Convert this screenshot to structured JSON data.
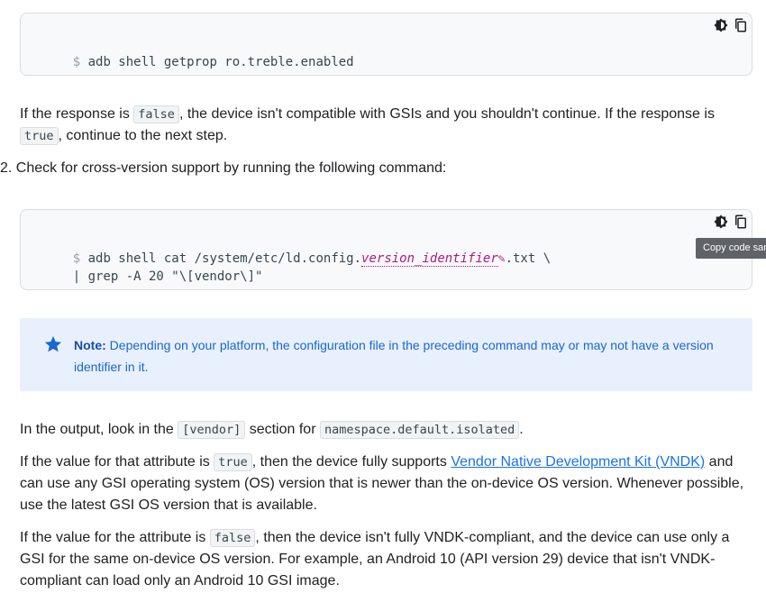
{
  "code_block_1": {
    "prompt": "$",
    "command": "adb shell getprop ro.treble.enabled"
  },
  "para_1": {
    "text_a": "If the response is ",
    "code_a": "false",
    "text_b": ", the device isn't compatible with GSIs and you shouldn't continue. If the response is",
    "code_b": "true",
    "text_c": ", continue to the next step."
  },
  "step_2": {
    "number": "2.",
    "text": "Check for cross-version support by running the following command:"
  },
  "code_block_2": {
    "prompt": "$",
    "line1_a": "adb shell cat /system/etc/ld.config.",
    "line1_var": "version_identifier",
    "line1_b": ".txt \\",
    "line2": "| grep -A 20 \"\\[vendor\\]\"",
    "tooltip": "Copy code sam"
  },
  "note": {
    "label": "Note:",
    "text": "Depending on your platform, the configuration file in the preceding command may or may not have a version identifier in it."
  },
  "para_2": {
    "text_a": "In the output, look in the ",
    "code_a": "[vendor]",
    "text_b": " section for ",
    "code_b": "namespace.default.isolated",
    "text_c": "."
  },
  "para_3": {
    "text_a": "If the value for that attribute is ",
    "code_a": "true",
    "text_b": ", then the device fully supports ",
    "link": "Vendor Native Development Kit (VNDK)",
    "text_c": " and can use any GSI operating system (OS) version that is newer than the on-device OS version. Whenever possible, use the latest GSI OS version that is available."
  },
  "para_4": {
    "text_a": "If the value for the attribute is ",
    "code_a": "false",
    "text_b": ", then the device isn't fully VNDK-compliant, and the device can use only a GSI for the same on-device OS version. For example, an Android 10 (API version 29) device that isn't VNDK-compliant can load only an Android 10 GSI image."
  },
  "icons": [
    "theme-toggle-icon",
    "copy-icon",
    "star-icon",
    "pencil-icon"
  ]
}
